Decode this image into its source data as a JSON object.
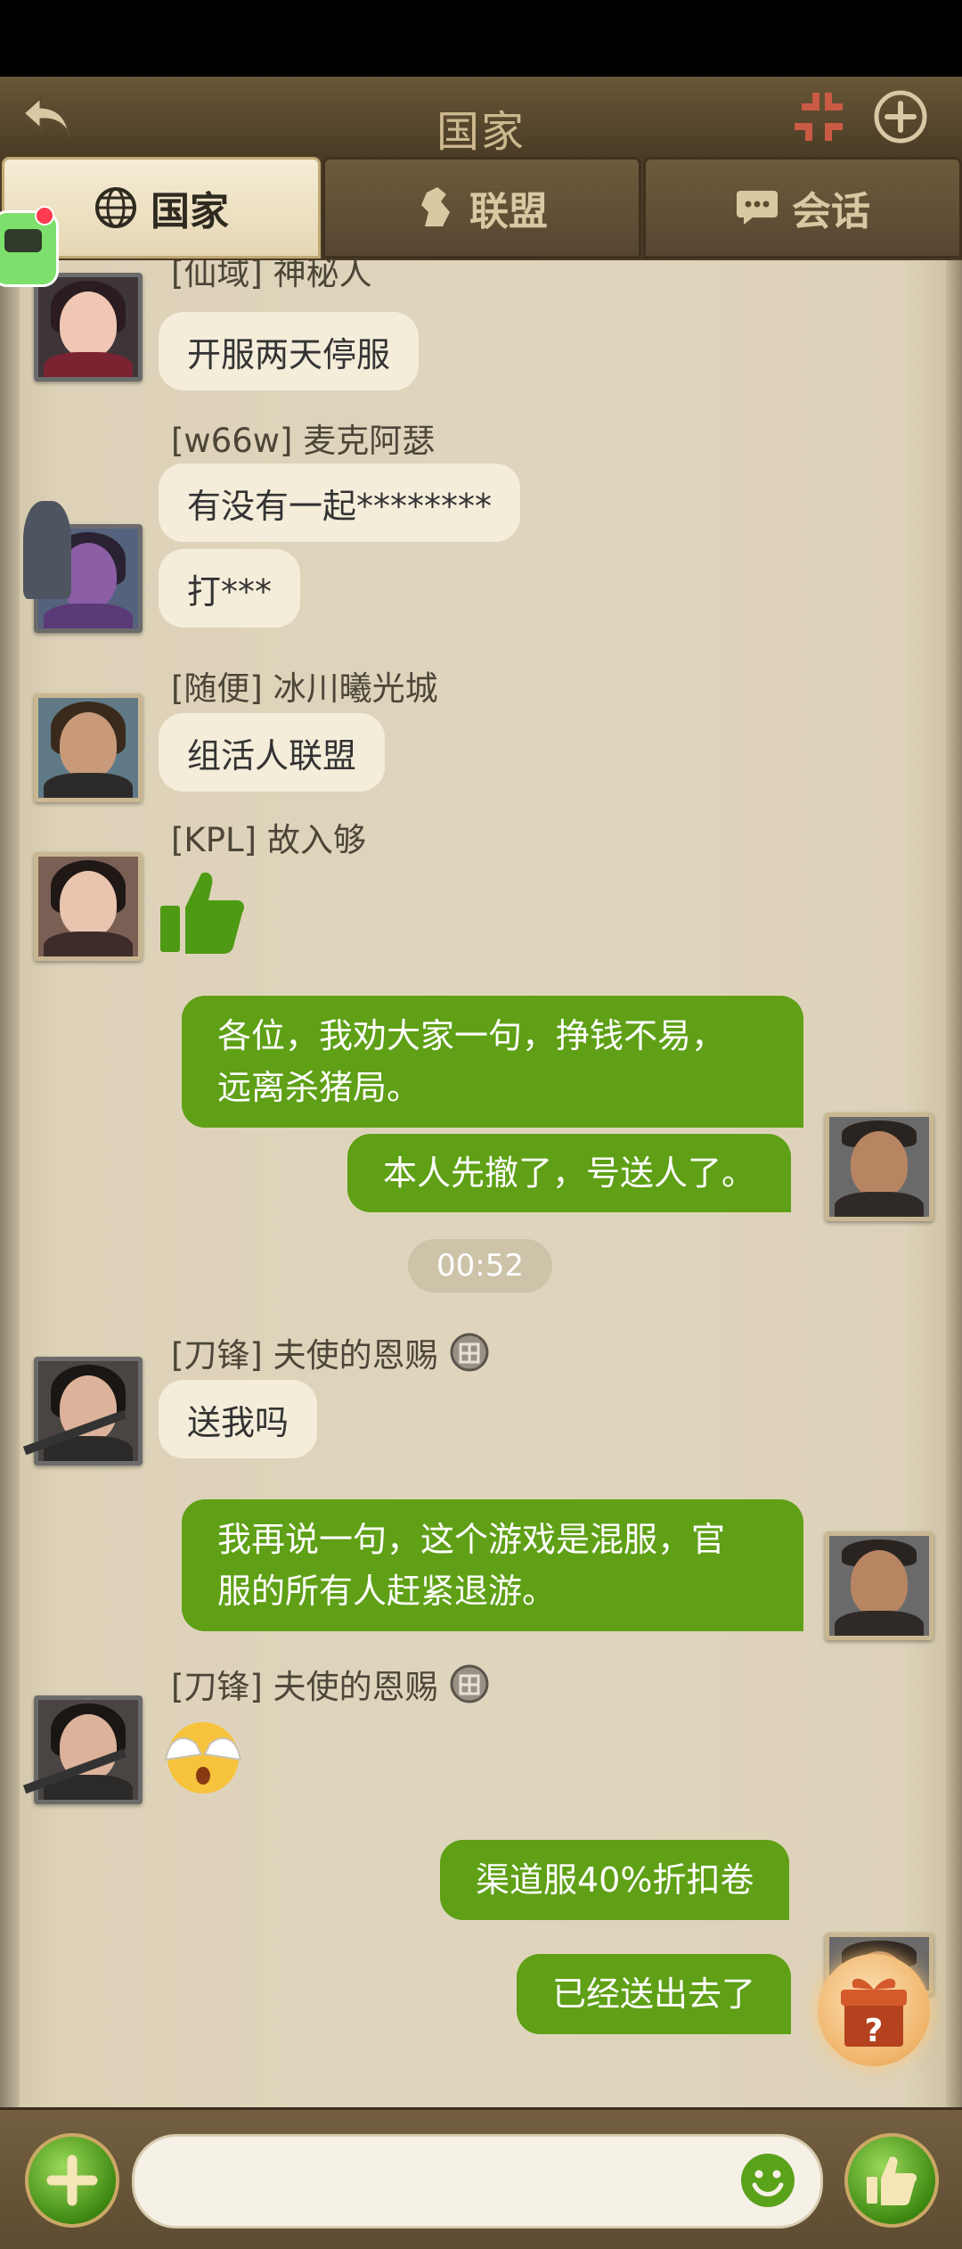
{
  "topbar": {
    "title": "国家"
  },
  "tabs": [
    {
      "label": "国家",
      "icon": "globe-icon",
      "active": true
    },
    {
      "label": "联盟",
      "icon": "alliance-knight-icon",
      "active": false
    },
    {
      "label": "会话",
      "icon": "chat-bubble-icon",
      "active": false
    }
  ],
  "messages": [
    {
      "sender": "[仙域] 神秘人",
      "lines": [
        "开服两天停服"
      ]
    },
    {
      "sender": "[w66w] 麦克阿瑟",
      "lines": [
        "有没有一起********",
        "打***"
      ]
    },
    {
      "sender": "[随便] 冰川曦光城",
      "lines": [
        "组活人联盟"
      ]
    },
    {
      "sender": "[KPL] 故入够",
      "sticker": "thumbs-up-sticker"
    },
    {
      "self": true,
      "lines": [
        "各位，我劝大家一句，挣钱不易，远离杀猪局。",
        "本人先撤了，号送人了。"
      ]
    },
    {
      "time": "00:52"
    },
    {
      "sender": "[刀锋] 夫使的恩赐",
      "lines": [
        "送我吗"
      ]
    },
    {
      "self": true,
      "lines": [
        "我再说一句，这个游戏是混服，官服的所有人赶紧退游。"
      ]
    },
    {
      "sender": "[刀锋] 夫使的恩赐",
      "sticker": "covering-eyes-emoji"
    },
    {
      "self": true,
      "lines": [
        "渠道服40%折扣卷",
        "已经送出去了"
      ]
    }
  ],
  "display": {
    "m1_line1": "开服两天停服",
    "m2_line1": "有没有一起********",
    "m2_line2": "打***",
    "m3_line1": "组活人联盟",
    "m5_line1a": "各位，我劝大家一句，挣钱不易，",
    "m5_line1b": "远离杀猪局。",
    "m5_line2": "本人先撤了，号送人了。",
    "m7_line1": "送我吗",
    "m8_line1a": "我再说一句，这个游戏是混服，官",
    "m8_line1b": "服的所有人赶紧退游。",
    "m10_line1": "渠道服40%折扣卷",
    "m10_line2": "已经送出去了"
  },
  "input": {
    "placeholder": ""
  },
  "colors": {
    "accent_green": "#5fa016",
    "bubble_in": "#f4edda",
    "chat_bg": "#dfd5bd"
  }
}
